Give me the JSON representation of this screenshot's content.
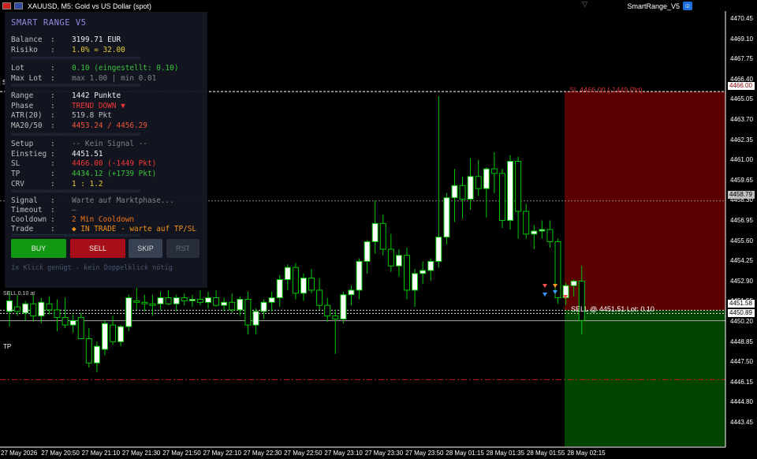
{
  "window": {
    "symbol_title": "XAUUSD, M5:  Gold vs US Dollar (spot)",
    "ea_name": "SmartRange_V5"
  },
  "panel": {
    "title": "SMART RANGE V5",
    "separator": "================================",
    "rows": [
      {
        "key": "Balance",
        "colon": ":",
        "value": "3199.71 EUR",
        "color": "#ffffff"
      },
      {
        "key": "Risiko",
        "colon": ":",
        "value": "1.0%  = 32.00",
        "color": "#f2d43c"
      },
      {
        "key": "Lot",
        "colon": ":",
        "value": "0.10  (eingestellt: 0.10)",
        "color": "#3fce3f"
      },
      {
        "key": "Max Lot",
        "colon": ":",
        "value": "max 1.00  |  min 0.01",
        "color": "#8a8a8a"
      },
      {
        "key": "Range",
        "colon": ":",
        "value": "1442 Punkte",
        "color": "#ffffff"
      },
      {
        "key": "Phase",
        "colon": ":",
        "value": "TREND DOWN ▼",
        "color": "#ff3b3b"
      },
      {
        "key": "ATR(20)",
        "colon": ":",
        "value": "519.8 Pkt",
        "color": "#c8c8c8"
      },
      {
        "key": "MA20/50",
        "colon": ":",
        "value": "4453.24 / 4456.29",
        "color": "#ff5a3c"
      },
      {
        "key": "Setup",
        "colon": ":",
        "value": "-- Kein Signal --",
        "color": "#8a8a8a"
      },
      {
        "key": "Einstieg",
        "colon": ":",
        "value": "4451.51",
        "color": "#ffffff"
      },
      {
        "key": "SL",
        "colon": ":",
        "value": "4466.00  (-1449 Pkt)",
        "color": "#ff3b3b"
      },
      {
        "key": "TP",
        "colon": ":",
        "value": "4434.12  (+1739 Pkt)",
        "color": "#3fce3f"
      },
      {
        "key": "CRV",
        "colon": ":",
        "value": "1 : 1.2",
        "color": "#f2d43c"
      },
      {
        "key": "Signal",
        "colon": ":",
        "value": "Warte auf Marktphase...",
        "color": "#8a8a8a"
      },
      {
        "key": "Timeout",
        "colon": ":",
        "value": "—",
        "color": "#8a8a8a"
      },
      {
        "key": "Cooldown",
        "colon": ":",
        "value": "2 Min Cooldown",
        "color": "#ff7a1a"
      },
      {
        "key": "Trade",
        "colon": ":",
        "value": "◆ IN TRADE - warte auf TP/SL",
        "color": "#ff9a1a"
      }
    ],
    "buttons": {
      "buy": "BUY",
      "sell": "SELL",
      "skip": "SKIP",
      "reset": "RST"
    },
    "hint": "1x Klick genügt - kein Doppelklick nötig"
  },
  "price_axis": {
    "ticks": [
      "4470.45",
      "4469.10",
      "4467.75",
      "4466.40",
      "4465.05",
      "4463.70",
      "4462.35",
      "4461.00",
      "4459.65",
      "4458.30",
      "4456.95",
      "4455.60",
      "4454.25",
      "4452.90",
      "4451.55",
      "4450.20",
      "4448.85",
      "4447.50",
      "4446.15",
      "4444.80",
      "4443.45"
    ],
    "sl_price": "4466.00",
    "level_price": "4458.79",
    "entry_price": "4451.58",
    "current_price": "4450.89",
    "sl_line_label": "S",
    "tp_line_label": "TP",
    "sl_zone_label": "SL 4466.00  (-1449 Pkt)",
    "position_label": "SELL @ 4451.51   Lot: 0.10",
    "entry_left_label": "SELL 0.10 at"
  },
  "time_axis": [
    "27 May 2026",
    "27 May 20:50",
    "27 May 21:10",
    "27 May 21:30",
    "27 May 21:50",
    "27 May 22:10",
    "27 May 22:30",
    "27 May 22:50",
    "27 May 23:10",
    "27 May 23:30",
    "27 May 23:50",
    "28 May 01:15",
    "28 May 01:35",
    "28 May 01:55",
    "28 May 02:15"
  ],
  "colors": {
    "background": "#000000",
    "bull": "#ffffff",
    "bear": "#000000",
    "wick": "#00c800",
    "sl_zone": "#5a0000",
    "tp_zone": "#004400",
    "sl_line": "#ffffff",
    "tp_line": "#c81e1e",
    "buy_button": "#12a012",
    "sell_button": "#b0101a",
    "skip_button": "#3c4556",
    "reset_button": "#2a303e"
  },
  "chart_data": {
    "type": "candlestick",
    "timeframe": "M5",
    "ylim": [
      4442.6,
      4471.1
    ],
    "candles": [
      [
        4451.5,
        4452.8,
        4450.5,
        4452.2
      ],
      [
        4451.8,
        4452.6,
        4451.2,
        4451.5
      ],
      [
        4451.4,
        4452.2,
        4450.9,
        4452.0
      ],
      [
        4452.0,
        4452.6,
        4450.8,
        4451.2
      ],
      [
        4451.2,
        4452.4,
        4450.7,
        4452.1
      ],
      [
        4452.0,
        4452.5,
        4451.3,
        4451.6
      ],
      [
        4451.6,
        4452.3,
        4450.2,
        4451.1
      ],
      [
        4451.1,
        4452.4,
        4450.4,
        4450.6
      ],
      [
        4450.6,
        4451.3,
        4450.1,
        4450.9
      ],
      [
        4451.1,
        4451.4,
        4450.8,
        4449.7
      ],
      [
        4449.7,
        4450.4,
        4447.8,
        4448.1
      ],
      [
        4448.1,
        4449.5,
        4447.5,
        4449.2
      ],
      [
        4449.0,
        4450.9,
        4448.6,
        4450.7
      ],
      [
        4450.6,
        4451.2,
        4449.3,
        4449.5
      ],
      [
        4449.5,
        4450.6,
        4449.2,
        4450.5
      ],
      [
        4450.5,
        4452.6,
        4450.2,
        4452.4
      ],
      [
        4452.2,
        4453.1,
        4451.6,
        4452.1
      ],
      [
        4452.1,
        4452.6,
        4451.5,
        4452.0
      ],
      [
        4452.0,
        4452.6,
        4451.2,
        4451.9
      ],
      [
        4452.0,
        4452.8,
        4451.6,
        4452.4
      ],
      [
        4452.4,
        4452.9,
        4451.9,
        4452.0
      ],
      [
        4452.0,
        4452.6,
        4451.5,
        4452.4
      ],
      [
        4452.4,
        4452.7,
        4451.9,
        4452.2
      ],
      [
        4452.2,
        4452.6,
        4451.8,
        4452.3
      ],
      [
        4452.3,
        4452.9,
        4451.9,
        4452.1
      ],
      [
        4452.1,
        4452.8,
        4451.7,
        4452.4
      ],
      [
        4452.4,
        4452.9,
        4451.8,
        4451.9
      ],
      [
        4451.9,
        4452.4,
        4451.5,
        4452.1
      ],
      [
        4452.1,
        4452.7,
        4451.4,
        4451.6
      ],
      [
        4451.6,
        4452.5,
        4451.2,
        4452.3
      ],
      [
        4452.3,
        4452.8,
        4450.0,
        4450.6
      ],
      [
        4450.6,
        4451.7,
        4450.0,
        4451.5
      ],
      [
        4451.5,
        4452.3,
        4451.0,
        4452.1
      ],
      [
        4452.1,
        4452.8,
        4451.5,
        4452.4
      ],
      [
        4452.4,
        4453.9,
        4451.8,
        4453.6
      ],
      [
        4453.6,
        4454.6,
        4452.9,
        4454.4
      ],
      [
        4454.4,
        4454.7,
        4452.3,
        4452.7
      ],
      [
        4452.7,
        4454.0,
        4452.2,
        4453.7
      ],
      [
        4453.7,
        4454.3,
        4452.7,
        4452.9
      ],
      [
        4452.9,
        4453.7,
        4451.6,
        4451.9
      ],
      [
        4451.9,
        4452.4,
        4450.8,
        4451.2
      ],
      [
        4451.2,
        4451.6,
        4448.7,
        4451.0
      ],
      [
        4451.0,
        4452.8,
        4450.7,
        4452.6
      ],
      [
        4452.6,
        4453.2,
        4451.9,
        4452.9
      ],
      [
        4452.9,
        4455.0,
        4452.3,
        4454.8
      ],
      [
        4454.8,
        4456.2,
        4454.0,
        4456.1
      ],
      [
        4456.1,
        4458.8,
        4455.3,
        4457.3
      ],
      [
        4457.3,
        4457.9,
        4455.2,
        4455.6
      ],
      [
        4455.6,
        4456.6,
        4454.1,
        4454.5
      ],
      [
        4454.5,
        4455.6,
        4453.8,
        4455.2
      ],
      [
        4455.2,
        4455.7,
        4452.3,
        4452.9
      ],
      [
        4452.9,
        4454.3,
        4451.8,
        4454.0
      ],
      [
        4454.0,
        4454.8,
        4453.3,
        4454.2
      ],
      [
        4454.2,
        4455.0,
        4453.5,
        4454.8
      ],
      [
        4454.8,
        4465.7,
        4454.4,
        4456.4
      ],
      [
        4456.4,
        4459.3,
        4455.9,
        4459.0
      ],
      [
        4459.0,
        4460.9,
        4457.4,
        4459.8
      ],
      [
        4459.8,
        4460.4,
        4457.6,
        4458.9
      ],
      [
        4458.9,
        4461.6,
        4458.2,
        4460.4
      ],
      [
        4460.4,
        4461.5,
        4459.1,
        4459.6
      ],
      [
        4459.6,
        4461.0,
        4457.7,
        4460.9
      ],
      [
        4460.9,
        4462.0,
        4459.3,
        4460.6
      ],
      [
        4460.6,
        4460.9,
        4457.0,
        4457.5
      ],
      [
        4457.5,
        4461.8,
        4456.9,
        4461.4
      ],
      [
        4461.4,
        4461.7,
        4456.3,
        4458.1
      ],
      [
        4458.1,
        4458.6,
        4456.3,
        4456.6
      ],
      [
        4456.6,
        4457.2,
        4455.6,
        4456.8
      ],
      [
        4456.8,
        4457.5,
        4456.3,
        4456.9
      ],
      [
        4456.9,
        4457.5,
        4455.7,
        4456.1
      ],
      [
        4456.1,
        4456.3,
        4452.0,
        4452.4
      ],
      [
        4452.4,
        4453.4,
        4451.9,
        4453.2
      ],
      [
        4453.2,
        4453.6,
        4452.5,
        4453.5
      ],
      [
        4453.5,
        4454.5,
        4450.0,
        4450.9
      ]
    ]
  }
}
